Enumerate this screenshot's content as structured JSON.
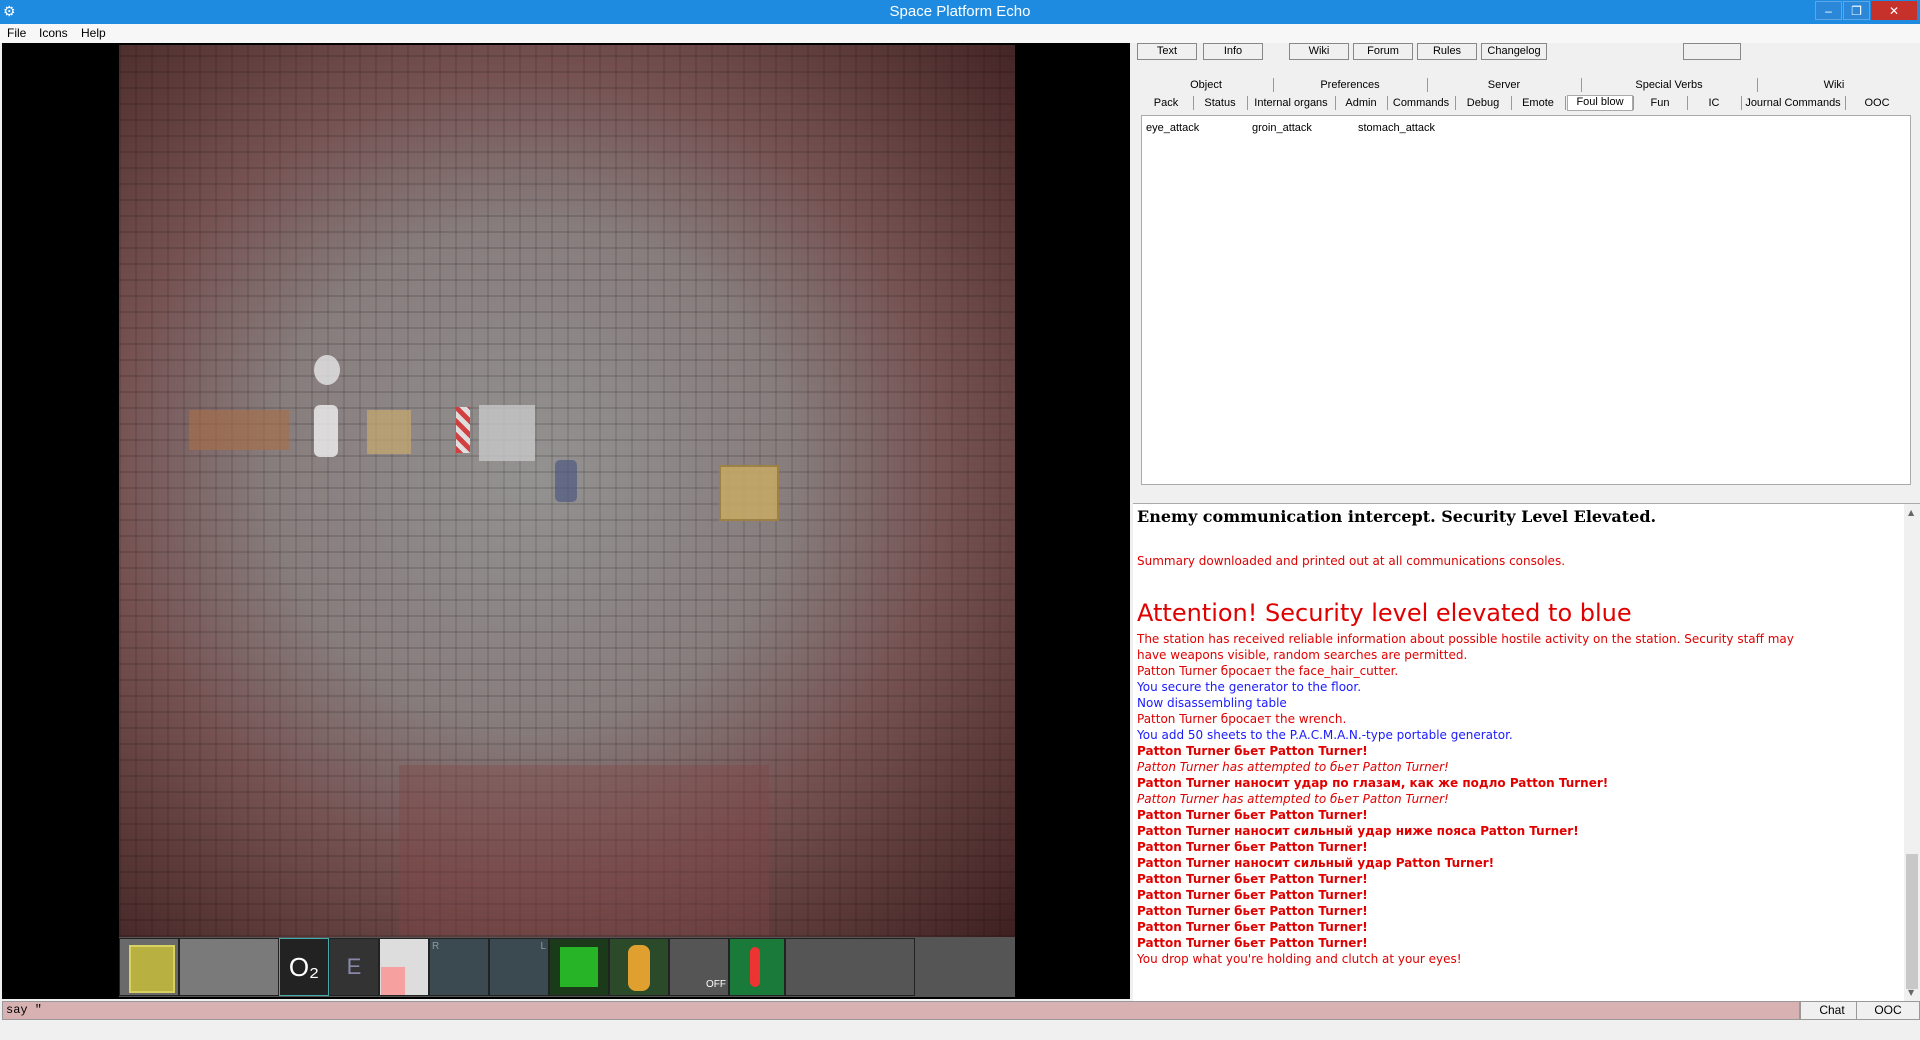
{
  "window": {
    "title": "Space Platform Echo",
    "icon": "gear-icon",
    "controls": {
      "minimize": "–",
      "restore": "❐",
      "close": "✕"
    },
    "accent_color": "#1e8be0"
  },
  "menu": {
    "items": [
      "File",
      "Icons",
      "Help"
    ]
  },
  "top_buttons": [
    "Text",
    "Info",
    "Wiki",
    "Forum",
    "Rules",
    "Changelog",
    ""
  ],
  "tabs_row1": [
    "Object",
    "Preferences",
    "Server",
    "Special Verbs",
    "Wiki"
  ],
  "tabs_row2": [
    "Pack",
    "Status",
    "Internal organs",
    "Admin",
    "Commands",
    "Debug",
    "Emote",
    "Foul blow",
    "Fun",
    "IC",
    "Journal Commands",
    "OOC"
  ],
  "verbs": [
    "eye_attack",
    "groin_attack",
    "stomach_attack"
  ],
  "output": {
    "header": "Enemy communication intercept.  Security Level Elevated.",
    "summary": "Summary downloaded and printed out at all communications consoles.",
    "attention": "Attention! Security level elevated to blue",
    "lines": [
      {
        "text": "The station has received reliable information about possible hostile activity on the station. Security staff may",
        "style": "red"
      },
      {
        "text": "have weapons visible, random searches are permitted.",
        "style": "red"
      },
      {
        "text": "Patton Turner бросает the face_hair_cutter.",
        "style": "red"
      },
      {
        "text": "You secure the generator to the floor.",
        "style": "blue"
      },
      {
        "text": "Now disassembling table",
        "style": "blue"
      },
      {
        "text": "Patton Turner бросает the wrench.",
        "style": "red"
      },
      {
        "text": "You add 50 sheets to the P.A.C.M.A.N.-type portable generator.",
        "style": "blue"
      },
      {
        "text": "Patton Turner бьет Patton Turner!",
        "style": "red bold"
      },
      {
        "text": "Patton Turner has attempted to бьет Patton Turner!",
        "style": "red ital"
      },
      {
        "text": "Patton Turner наносит удар по глазам, как же подло Patton Turner!",
        "style": "red bold"
      },
      {
        "text": "Patton Turner has attempted to бьет Patton Turner!",
        "style": "red ital"
      },
      {
        "text": "Patton Turner бьет Patton Turner!",
        "style": "red bold"
      },
      {
        "text": "Patton Turner наносит сильный удар ниже пояса Patton Turner!",
        "style": "red bold"
      },
      {
        "text": "Patton Turner бьет Patton Turner!",
        "style": "red bold"
      },
      {
        "text": "Patton Turner наносит сильный удар Patton Turner!",
        "style": "red bold"
      },
      {
        "text": "Patton Turner бьет Patton Turner!",
        "style": "red bold"
      },
      {
        "text": "Patton Turner бьет Patton Turner!",
        "style": "red bold"
      },
      {
        "text": "Patton Turner бьет Patton Turner!",
        "style": "red bold"
      },
      {
        "text": "Patton Turner бьет Patton Turner!",
        "style": "red bold"
      },
      {
        "text": "Patton Turner бьет Patton Turner!",
        "style": "red bold"
      },
      {
        "text": "You drop what you're holding and clutch at your eyes!",
        "style": "red"
      }
    ]
  },
  "chat": {
    "input_value": "say \"",
    "buttons": [
      "Chat",
      "OOC"
    ]
  },
  "hud": {
    "labels": {
      "oxygen": "O₂",
      "internals": "E",
      "hand_right": "R",
      "hand_left": "L",
      "toggle": "OFF"
    },
    "icons": [
      "storage-icon",
      "oxygen-icon",
      "internals-icon",
      "intent-icon",
      "right-hand-icon",
      "left-hand-icon",
      "running-icon",
      "health-doll-icon",
      "pressure-icon",
      "temperature-icon",
      "pocket-icon"
    ]
  },
  "colors": {
    "alert_red": "#e00000",
    "info_blue": "#1a1aff",
    "chat_input_bg": "#d8b2b2"
  }
}
